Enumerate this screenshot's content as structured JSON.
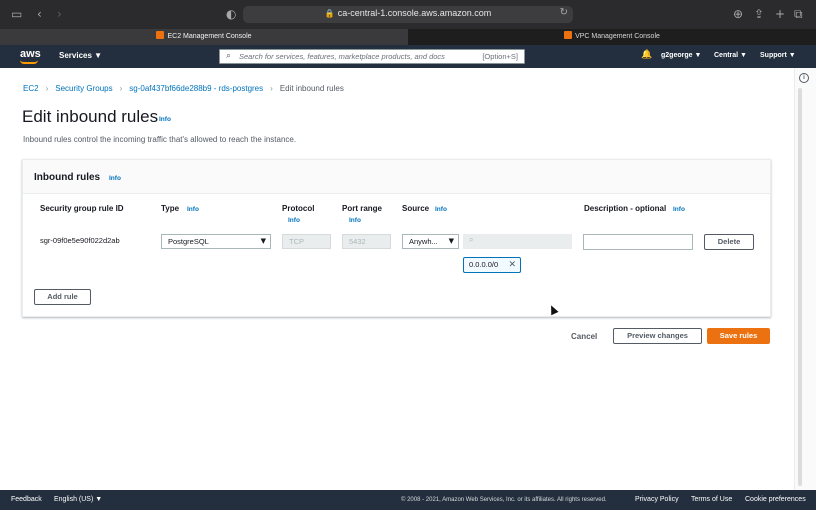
{
  "browser": {
    "url": "ca-central-1.console.aws.amazon.com",
    "tabs": [
      {
        "label": "EC2 Management Console",
        "active": true
      },
      {
        "label": "VPC Management Console",
        "active": false
      }
    ]
  },
  "nav": {
    "logo": "aws",
    "services": "Services ▼",
    "search_placeholder": "Search for services, features, marketplace products, and docs",
    "search_shortcut": "[Option+S]",
    "user": "g2george ▼",
    "region": "Central ▼",
    "support": "Support ▼"
  },
  "breadcrumb": {
    "items": [
      "EC2",
      "Security Groups",
      "sg-0af437bf66de288b9 - rds-postgres",
      "Edit inbound rules"
    ]
  },
  "page": {
    "title": "Edit inbound rules",
    "title_info": "Info",
    "description": "Inbound rules control the incoming traffic that's allowed to reach the instance."
  },
  "panel": {
    "title": "Inbound rules",
    "info": "Info",
    "columns": {
      "rule_id": "Security group rule ID",
      "type": "Type",
      "protocol": "Protocol",
      "port_range": "Port range",
      "source": "Source",
      "description": "Description - optional"
    },
    "info_label": "Info",
    "row": {
      "rule_id": "sgr-09f0e5e90f022d2ab",
      "type": "PostgreSQL",
      "protocol": "TCP",
      "port_range": "5432",
      "source_type": "Anywh...",
      "source_token": "0.0.0.0/0",
      "description": "",
      "delete_label": "Delete"
    },
    "add_rule": "Add rule"
  },
  "actions": {
    "cancel": "Cancel",
    "preview": "Preview changes",
    "save": "Save rules"
  },
  "footer": {
    "feedback": "Feedback",
    "language": "English (US) ▼",
    "copyright": "© 2008 - 2021, Amazon Web Services, Inc. or its affiliates. All rights reserved.",
    "privacy": "Privacy Policy",
    "terms": "Terms of Use",
    "cookies": "Cookie preferences"
  },
  "colors": {
    "aws_nav": "#232f3e",
    "accent_orange": "#ec7211",
    "link_blue": "#0073bb"
  }
}
